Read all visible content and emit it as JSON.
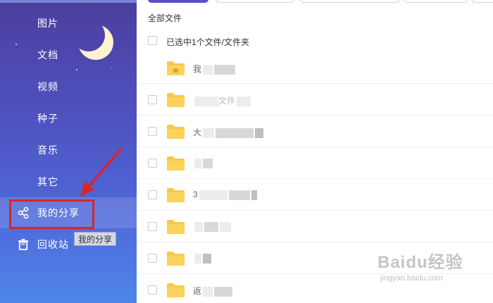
{
  "sidebar": {
    "items": [
      {
        "label": "图片"
      },
      {
        "label": "文档"
      },
      {
        "label": "视频"
      },
      {
        "label": "种子"
      },
      {
        "label": "音乐"
      },
      {
        "label": "其它"
      },
      {
        "label": "我的分享"
      },
      {
        "label": "回收站"
      }
    ],
    "tooltip": "我的分享"
  },
  "main": {
    "breadcrumb": "全部文件",
    "selection_text": "已选中1个文件/文件夹",
    "files": [
      {
        "name": "我"
      },
      {
        "name": "文件"
      },
      {
        "name": "大"
      },
      {
        "name": ""
      },
      {
        "name": "3"
      },
      {
        "name": ""
      },
      {
        "name": ""
      },
      {
        "name": "返"
      }
    ]
  },
  "watermark": {
    "brand": "Baidu经验",
    "url": "jingyan.baidu.com"
  },
  "colors": {
    "accent": "#5b4fc9",
    "folder": "#f7c94a",
    "highlight": "#d9252a"
  }
}
